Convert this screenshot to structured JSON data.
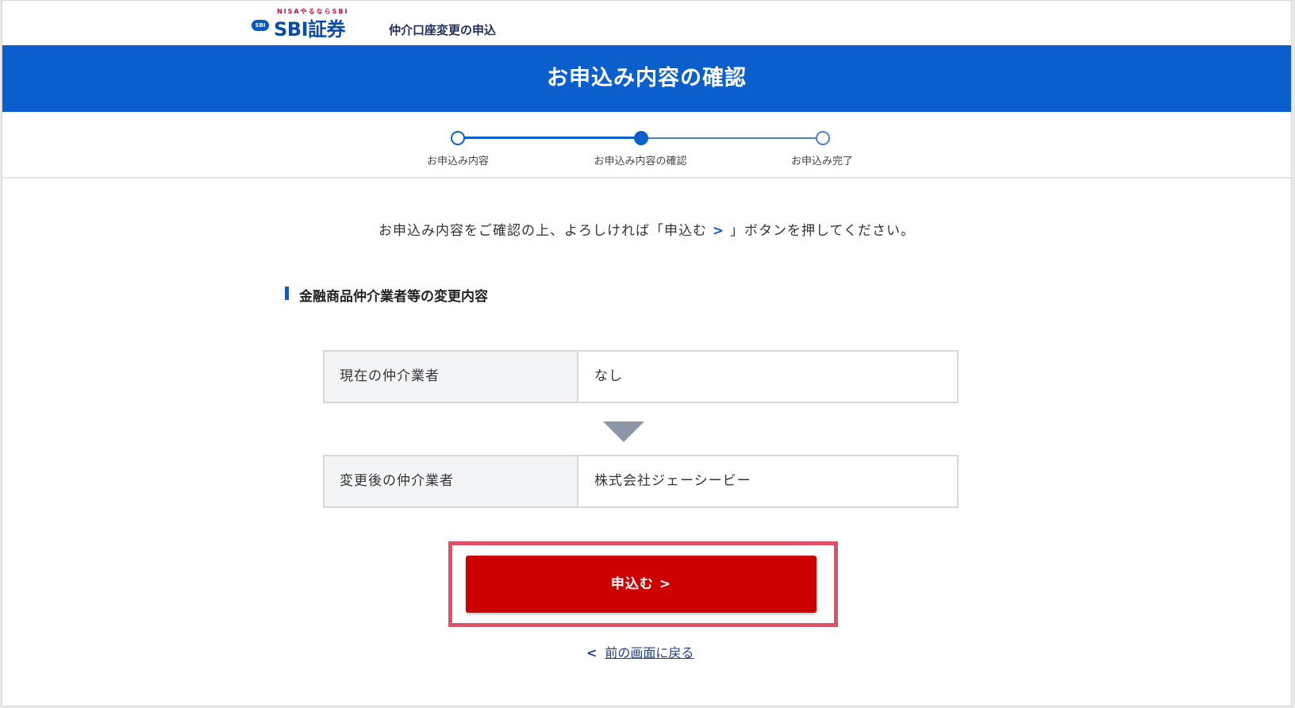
{
  "header": {
    "logo_tag": "NISAやるならSBI",
    "logo_badge": "SBI",
    "logo_text": "SBI証券",
    "subtitle": "仲介口座変更の申込"
  },
  "page_title": "お申込み内容の確認",
  "stepper": {
    "steps": [
      {
        "label": "お申込み内容"
      },
      {
        "label": "お申込み内容の確認"
      },
      {
        "label": "お申込み完了"
      }
    ],
    "current_step": 2
  },
  "instruction": {
    "before": "お申込み内容をご確認の上、よろしければ「申込む",
    "chev": " > ",
    "after": "」ボタンを押してください。"
  },
  "section": {
    "title": "金融商品仲介業者等の変更内容",
    "rows": [
      {
        "label": "現在の仲介業者",
        "value": "なし"
      },
      {
        "label": "変更後の仲介業者",
        "value": "株式会社ジェーシービー"
      }
    ]
  },
  "apply_button": {
    "label": "申込む >"
  },
  "back_link": {
    "chev": "<",
    "label": "前の画面に戻る"
  },
  "colors": {
    "primary_blue": "#0b5fcd",
    "apply_red": "#cc0000",
    "highlight_pink": "#e0506a"
  }
}
